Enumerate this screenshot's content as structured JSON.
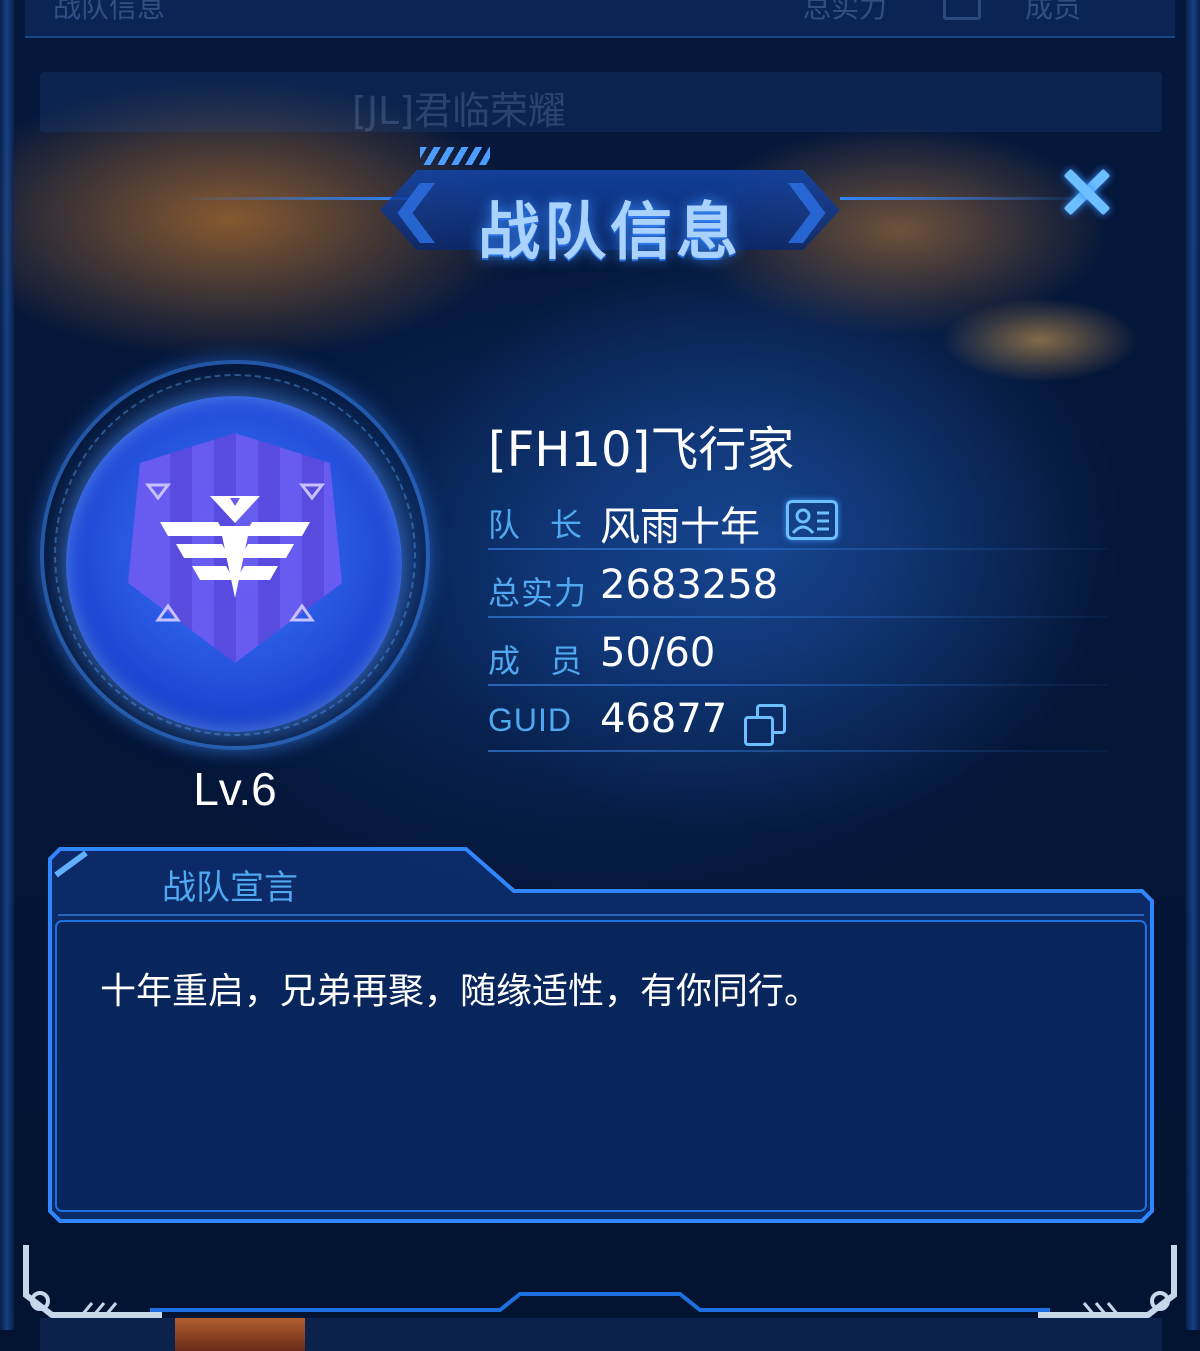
{
  "background": {
    "header_left": "战队信息",
    "header_mid": "总实力",
    "header_right": "成员",
    "row_text": "[JL]君临荣耀"
  },
  "dialog": {
    "title": "战队信息",
    "close_icon": "close-icon"
  },
  "team": {
    "name": "[FH10]飞行家",
    "level": "Lv.6",
    "captain_label": "队长",
    "captain": "风雨十年",
    "power_label": "总实力",
    "power": "2683258",
    "members_label": "成员",
    "members": "50/60",
    "guid_label": "GUID",
    "guid": "46877"
  },
  "declaration": {
    "title": "战队宣言",
    "text": "十年重启，兄弟再聚，随缘适性，有你同行。"
  },
  "colors": {
    "accent": "#4fa8f0",
    "icon": "#6cc0ff",
    "emblem": "#2a57e6"
  }
}
